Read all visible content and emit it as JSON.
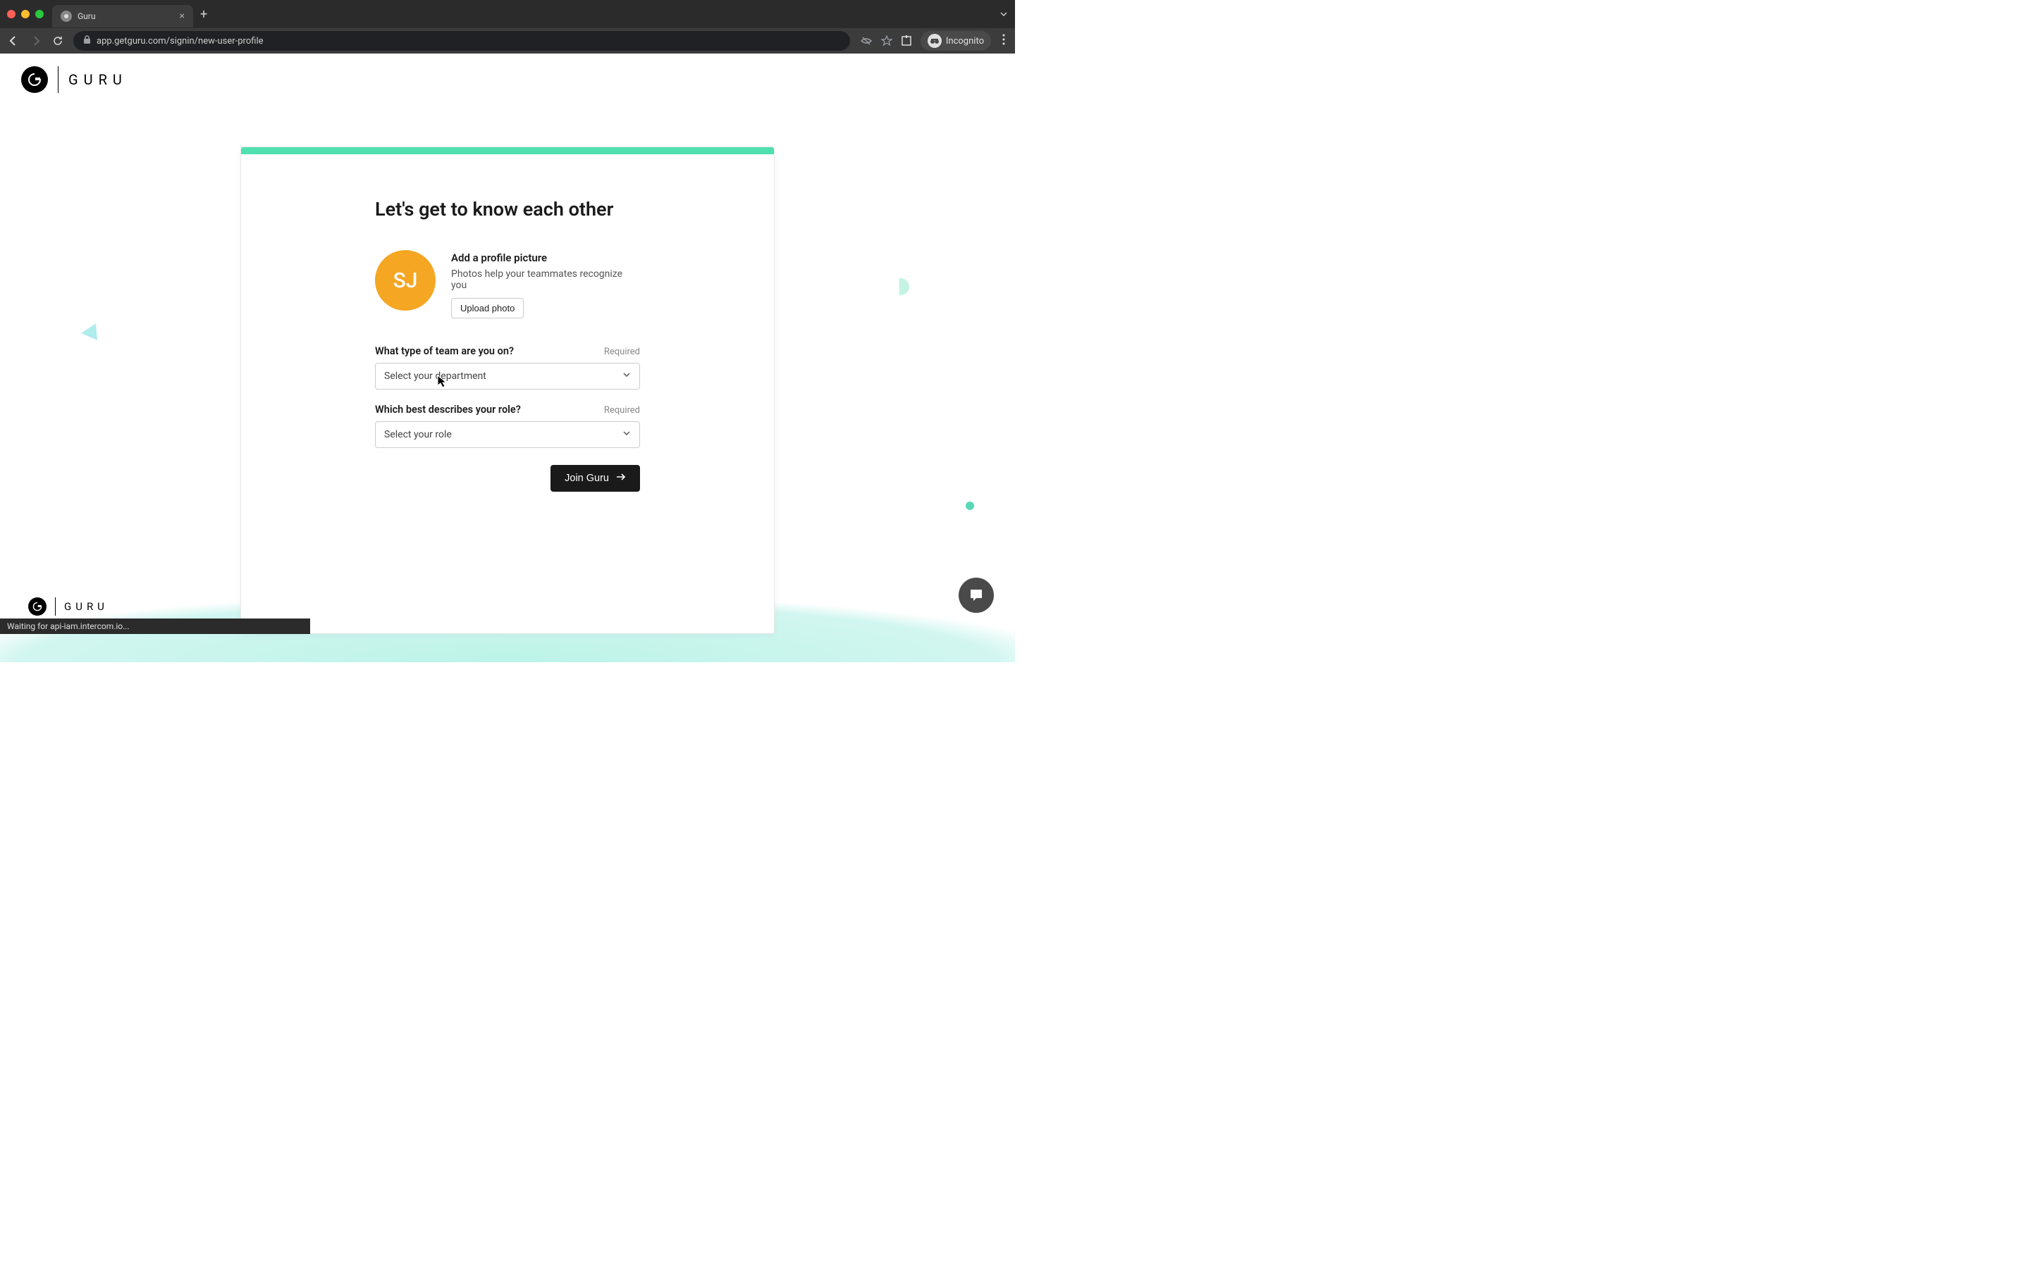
{
  "browser": {
    "tab_title": "Guru",
    "url": "app.getguru.com/signin/new-user-profile",
    "incognito_label": "Incognito"
  },
  "header": {
    "brand": "GURU"
  },
  "card": {
    "title": "Let's get to know each other",
    "avatar_initials": "SJ",
    "profile": {
      "heading": "Add a profile picture",
      "subtext": "Photos help your teammates recognize you",
      "upload_label": "Upload photo"
    },
    "team_field": {
      "label": "What type of team are you on?",
      "required": "Required",
      "placeholder": "Select your department"
    },
    "role_field": {
      "label": "Which best describes your role?",
      "required": "Required",
      "placeholder": "Select your role"
    },
    "submit_label": "Join Guru"
  },
  "footer": {
    "brand": "GURU"
  },
  "status_bar": "Waiting for api-iam.intercom.io..."
}
